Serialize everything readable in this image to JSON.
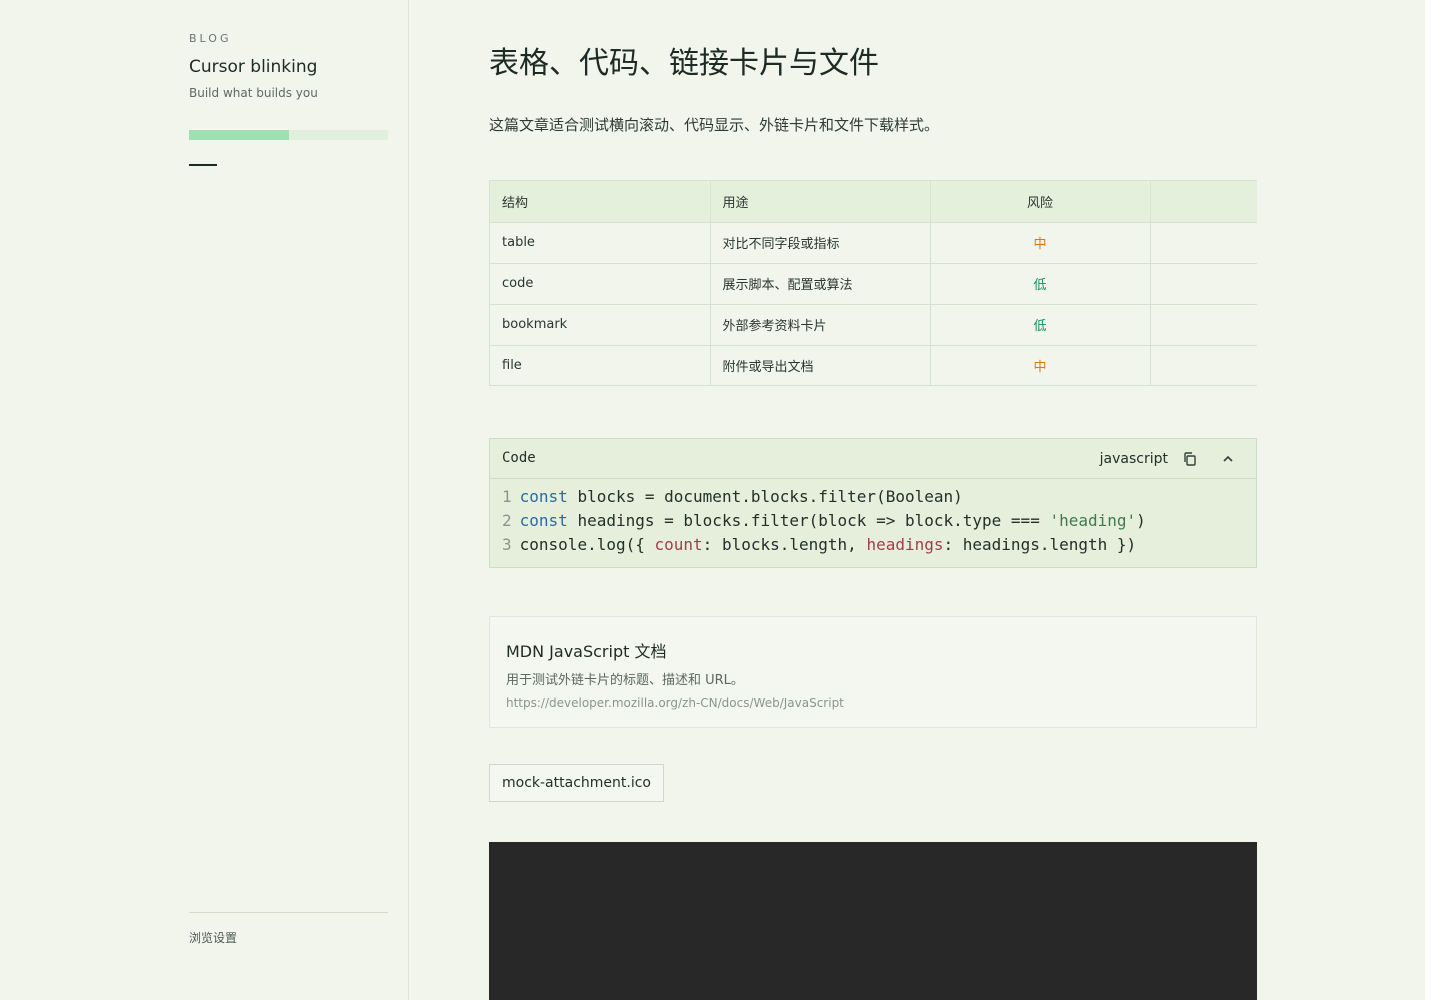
{
  "sidebar": {
    "brand_tag": "BLOG",
    "site_title": "Cursor blinking",
    "site_subtitle": "Build what builds you",
    "reading_progress": 0.5,
    "settings_label": "浏览设置"
  },
  "article": {
    "title": "表格、代码、链接卡片与文件",
    "intro": "这篇文章适合测试横向滚动、代码显示、外链卡片和文件下载样式。"
  },
  "table": {
    "headers": [
      "结构",
      "用途",
      "风险",
      ""
    ],
    "rows": [
      {
        "structure": "table",
        "purpose": "对比不同字段或指标",
        "risk": "中",
        "extra": ""
      },
      {
        "structure": "code",
        "purpose": "展示脚本、配置或算法",
        "risk": "低",
        "extra": ""
      },
      {
        "structure": "bookmark",
        "purpose": "外部参考资料卡片",
        "risk": "低",
        "extra": ""
      },
      {
        "structure": "file",
        "purpose": "附件或导出文档",
        "risk": "中",
        "extra": ""
      }
    ],
    "risk_colors": {
      "中": "#d97a0c",
      "低": "#12915c"
    }
  },
  "code_block": {
    "title": "Code",
    "language": "javascript",
    "lines": [
      "const blocks = document.blocks.filter(Boolean)",
      "const headings = blocks.filter(block => block.type === 'heading')",
      "console.log({ count: blocks.length, headings: headings.length })"
    ],
    "icons": [
      "copy-icon",
      "chevron-up-icon"
    ]
  },
  "bookmark": {
    "title": "MDN JavaScript 文档",
    "description": "用于测试外链卡片的标题、描述和 URL。",
    "url": "https://developer.mozilla.org/zh-CN/docs/Web/JavaScript"
  },
  "file": {
    "name": "mock-attachment.ico"
  },
  "colors": {
    "background": "#f1f5ec",
    "accent": "#9fdfb2",
    "table_header": "#e4efdc",
    "media_block": "#282828"
  }
}
